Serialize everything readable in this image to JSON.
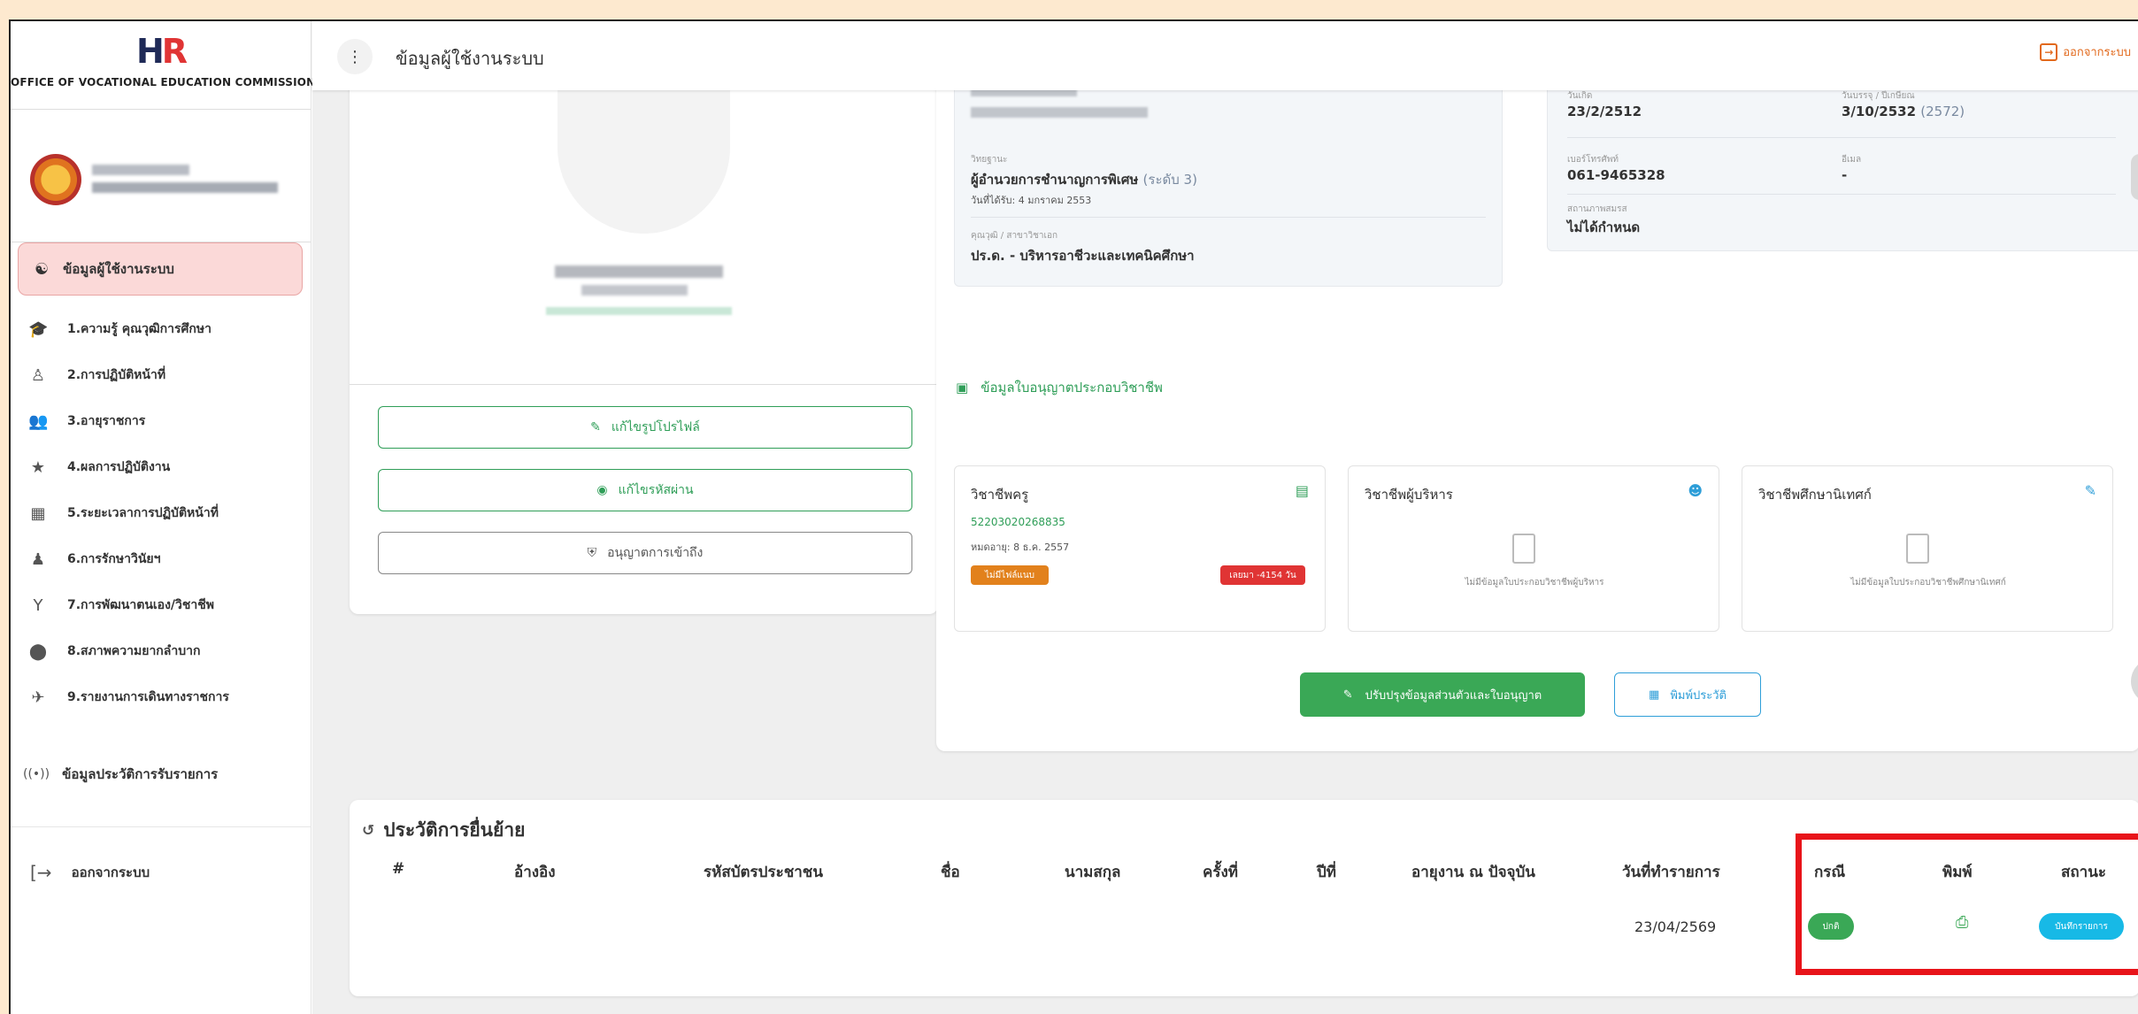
{
  "header": {
    "page_title": "ข้อมูลผู้ใช้งานระบบ",
    "logout_label": "ออกจากระบบ"
  },
  "sidebar": {
    "logo_text_h": "H",
    "logo_text_r": "R",
    "logo_subtitle": "OFFICE OF VOCATIONAL EDUCATION COMMISSION",
    "active_item": "ข้อมูลผู้ใช้งานระบบ",
    "items": [
      {
        "label": "1.ความรู้ คุณวุฒิการศึกษา",
        "icon": "graduation-cap-icon",
        "glyph": "🎓"
      },
      {
        "label": "2.การปฏิบัติหน้าที่",
        "icon": "user-desk-icon",
        "glyph": "♙"
      },
      {
        "label": "3.อายุราชการ",
        "icon": "users-icon",
        "glyph": "👥"
      },
      {
        "label": "4.ผลการปฏิบัติงาน",
        "icon": "award-icon",
        "glyph": "★"
      },
      {
        "label": "5.ระยะเวลาการปฏิบัติหน้าที่",
        "icon": "calendar-clock-icon",
        "glyph": "▦"
      },
      {
        "label": "6.การรักษาวินัยฯ",
        "icon": "person-shield-icon",
        "glyph": "♟"
      },
      {
        "label": "7.การพัฒนาตนเอง/วิชาชีพ",
        "icon": "trophy-icon",
        "glyph": "Y"
      },
      {
        "label": "8.สภาพความยากลำบาก",
        "icon": "map-pin-icon",
        "glyph": "⬤"
      },
      {
        "label": "9.รายงานการเดินทางราชการ",
        "icon": "airplane-icon",
        "glyph": "✈"
      }
    ],
    "history_item": "ข้อมูลประวัติการรับรายการ",
    "logout_label": "ออกจากระบบ"
  },
  "profile": {
    "edit_photo_label": "แก้ไขรูปโปรไฟล์",
    "edit_password_label": "แก้ไขรหัสผ่าน",
    "permission_label": "อนุญาตการเข้าถึง"
  },
  "info": {
    "position_label": "วิทยฐานะ",
    "position_value": "ผู้อำนวยการชำนาญการพิเศษ",
    "position_level": "(ระดับ 3)",
    "position_since": "วันที่ได้รับ: 4 มกราคม 2553",
    "degree_label": "คุณวุฒิ / สาขาวิชาเอก",
    "degree_value": "ปร.ด. - บริหารอาชีวะและเทคนิคศึกษา",
    "birth_label": "วันเกิด",
    "birth_value": "23/2/2512",
    "start_label": "วันบรรจุ / ปีเกษียณ",
    "start_value": "3/10/2532",
    "retire_year": "(2572)",
    "phone_label": "เบอร์โทรศัพท์",
    "phone_value": "061-9465328",
    "email_label": "อีเมล",
    "email_value": "-",
    "marital_label": "สถานภาพสมรส",
    "marital_value": "ไม่ได้กำหนด"
  },
  "license_section": {
    "title": "ข้อมูลใบอนุญาตประกอบวิชาชีพ",
    "cards": [
      {
        "title": "วิชาชีพครู",
        "number": "52203020268835",
        "expiry": "หมดอายุ: 8 ธ.ค. 2557",
        "tag_status": "ไม่มีไฟล์แนบ",
        "tag_expired": "เลยมา -4154 วัน",
        "empty_text": ""
      },
      {
        "title": "วิชาชีพผู้บริหาร",
        "empty_text": "ไม่มีข้อมูลใบประกอบวิชาชีพผู้บริหาร"
      },
      {
        "title": "วิชาชีพศึกษานิเทศก์",
        "empty_text": "ไม่มีข้อมูลใบประกอบวิชาชีพศึกษานิเทศก์"
      }
    ],
    "update_button": "ปรับปรุงข้อมูลส่วนตัวและใบอนุญาต",
    "print_button": "พิมพ์ประวัติ"
  },
  "history": {
    "title": "ประวัติการยื่นย้าย",
    "columns": [
      "#",
      "อ้างอิง",
      "รหัสบัตรประชาชน",
      "ชื่อ",
      "นามสกุล",
      "ครั้งที่",
      "ปีที่",
      "อายุงาน ณ ปัจจุบัน",
      "วันที่ทำรายการ",
      "กรณี",
      "พิมพ์",
      "สถานะ"
    ],
    "rows": [
      {
        "date": "23/04/2569",
        "case": "ปกติ",
        "status": "บันทึกรายการ"
      }
    ]
  },
  "colors": {
    "accent_green": "#3aa856",
    "accent_blue": "#2e9ed8",
    "orange": "#e2691c",
    "danger_red": "#e03434",
    "highlight_red": "#e8141a",
    "status_teal": "#17b9e6"
  }
}
